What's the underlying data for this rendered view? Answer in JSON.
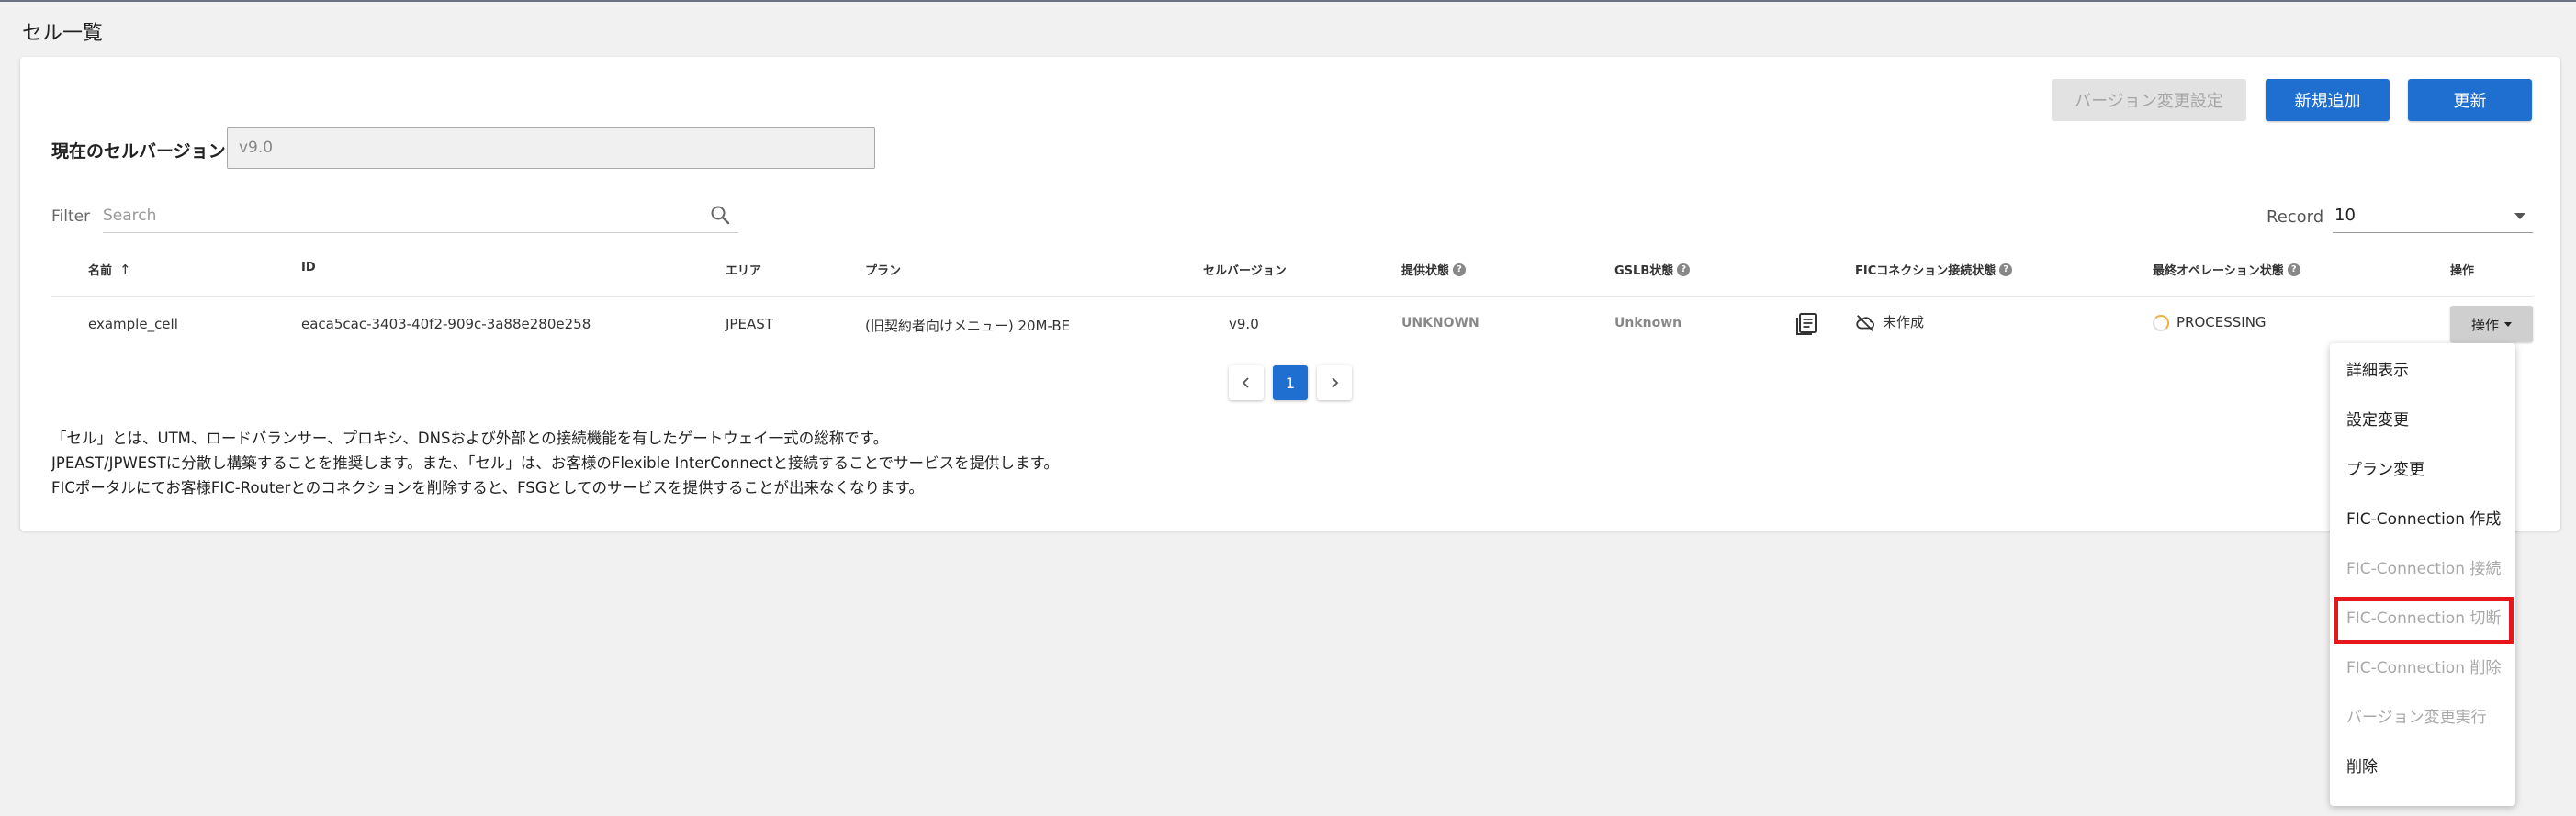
{
  "page": {
    "title": "セル一覧"
  },
  "toolbar": {
    "version_change_setting": "バージョン変更設定",
    "add_new": "新規追加",
    "refresh": "更新"
  },
  "version": {
    "label": "現在のセルバージョン",
    "value": "v9.0"
  },
  "filter": {
    "label": "Filter",
    "placeholder": "Search"
  },
  "record": {
    "label": "Record",
    "value": "10"
  },
  "table": {
    "headers": {
      "name": "名前",
      "sort_indicator": "↑",
      "id": "ID",
      "area": "エリア",
      "plan": "プラン",
      "cell_version": "セルバージョン",
      "provision_status": "提供状態",
      "gslb_status": "GSLB状態",
      "fic_status": "FICコネクション接続状態",
      "last_op_status": "最終オペレーション状態",
      "actions": "操作"
    },
    "rows": [
      {
        "name": "example_cell",
        "id": "eaca5cac-3403-40f2-909c-3a88e280e258",
        "area": "JPEAST",
        "plan": "(旧契約者向けメニュー) 20M-BE",
        "cell_version": "v9.0",
        "provision_status": "UNKNOWN",
        "gslb_status": "Unknown",
        "fic_status": "未作成",
        "last_op_status": "PROCESSING",
        "actions_label": "操作"
      }
    ]
  },
  "pagination": {
    "current": "1",
    "prev_icon": "chevron-left-icon",
    "next_icon": "chevron-right-icon"
  },
  "description": [
    "「セル」とは、UTM、ロードバランサー、プロキシ、DNSおよび外部との接続機能を有したゲートウェイ一式の総称です。",
    "JPEAST/JPWESTに分散し構築することを推奨します。また、「セル」は、お客様のFlexible InterConnectと接続することでサービスを提供します。",
    "FICポータルにてお客様FIC-Routerとのコネクションを削除すると、FSGとしてのサービスを提供することが出来なくなります。"
  ],
  "menu": {
    "items": [
      {
        "label": "詳細表示",
        "enabled": true
      },
      {
        "label": "設定変更",
        "enabled": true
      },
      {
        "label": "プラン変更",
        "enabled": true
      },
      {
        "label": "FIC-Connection 作成",
        "enabled": true
      },
      {
        "label": "FIC-Connection 接続",
        "enabled": false
      },
      {
        "label": "FIC-Connection 切断",
        "enabled": false
      },
      {
        "label": "FIC-Connection 削除",
        "enabled": false
      },
      {
        "label": "バージョン変更実行",
        "enabled": false
      },
      {
        "label": "削除",
        "enabled": true
      }
    ]
  },
  "colors": {
    "primary": "#1e6fd0",
    "highlight": "#e5161c",
    "spinner": "#f0b13b"
  }
}
